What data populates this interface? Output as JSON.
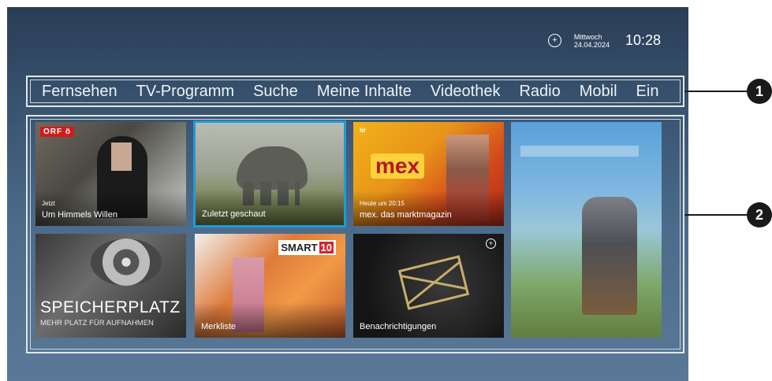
{
  "status": {
    "icon": "chat-bubble-icon",
    "weekday": "Mittwoch",
    "date": "24.04.2024",
    "time": "10:28"
  },
  "nav": {
    "items": [
      "Fernsehen",
      "TV-Programm",
      "Suche",
      "Meine Inhalte",
      "Videothek",
      "Radio",
      "Mobil",
      "Ein"
    ]
  },
  "tiles": {
    "t1": {
      "channel": "ORF ö",
      "sub": "Jetzt",
      "label": "Um Himmels Willen"
    },
    "t2": {
      "label": "Zuletzt geschaut"
    },
    "t3": {
      "channel": "hr",
      "logo": "mex",
      "sub": "Heute um 20:15",
      "label": "mex. das marktmagazin"
    },
    "t5": {
      "title": "SPEICHERPLATZ",
      "subtitle": "MEHR PLATZ FÜR AUFNAHMEN"
    },
    "t6": {
      "logo": "SMART",
      "logo_num": "10",
      "label": "Merkliste"
    },
    "t7": {
      "icon": "chat-bubble-icon",
      "label": "Benachrichtigungen"
    }
  },
  "callouts": {
    "one": "1",
    "two": "2"
  },
  "colors": {
    "focus": "#1f9bd8",
    "orf_red": "#d21c1c"
  }
}
